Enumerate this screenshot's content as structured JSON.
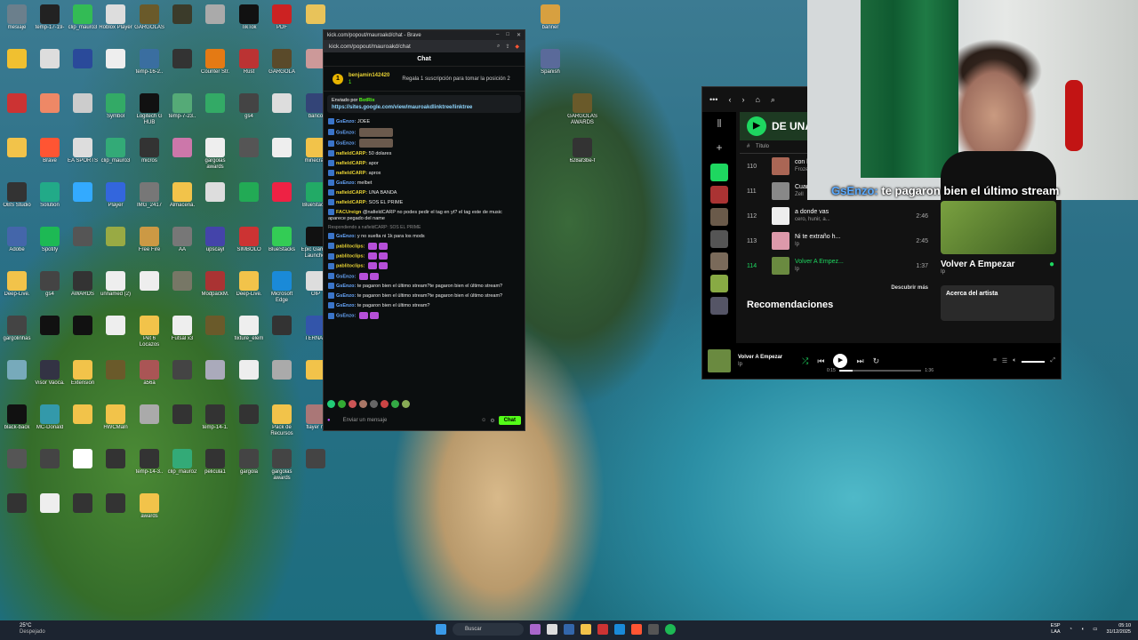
{
  "desktop_icons": [
    {
      "label": "mesiaje",
      "color": "#6b7f8c"
    },
    {
      "label": "temp-17-19-",
      "color": "#222"
    },
    {
      "label": "clip_mauro3",
      "color": "#3b5"
    },
    {
      "label": "Roblox Player",
      "color": "#ddd"
    },
    {
      "label": "GARGOLAS",
      "color": "#6a5a2a"
    },
    {
      "label": "",
      "color": "#3b3b2a"
    },
    {
      "label": "",
      "color": "#aaa"
    },
    {
      "label": "TikTok",
      "color": "#111"
    },
    {
      "label": "PDF",
      "color": "#c22"
    },
    {
      "label": "",
      "color": "#e8c35a"
    },
    {
      "label": "",
      "color": "#f0c030"
    },
    {
      "label": "",
      "color": "#ddd"
    },
    {
      "label": "",
      "color": "#2a4a9a"
    },
    {
      "label": "",
      "color": "#eee"
    },
    {
      "label": "temp-16-2..",
      "color": "#3a6ea0"
    },
    {
      "label": "",
      "color": "#333"
    },
    {
      "label": "Counter Str.",
      "color": "#e47a14"
    },
    {
      "label": "Rust",
      "color": "#b33"
    },
    {
      "label": "GARGOLA",
      "color": "#5a4a2a"
    },
    {
      "label": "",
      "color": "#c99"
    },
    {
      "label": "",
      "color": "#c33"
    },
    {
      "label": "",
      "color": "#e86"
    },
    {
      "label": "",
      "color": "#ccc"
    },
    {
      "label": "Symbol",
      "color": "#3a6"
    },
    {
      "label": "Logitech G HUB",
      "color": "#111"
    },
    {
      "label": "temp-7-23..",
      "color": "#5a7"
    },
    {
      "label": "",
      "color": "#3a6"
    },
    {
      "label": "gs4",
      "color": "#444"
    },
    {
      "label": "",
      "color": "#ddd"
    },
    {
      "label": "banco",
      "color": "#347"
    },
    {
      "label": "",
      "color": "#f2c34a"
    },
    {
      "label": "Brave",
      "color": "#f53"
    },
    {
      "label": "EA SPORTS",
      "color": "#ddd"
    },
    {
      "label": "clip_mauro3",
      "color": "#3a7"
    },
    {
      "label": "micros",
      "color": "#333"
    },
    {
      "label": "",
      "color": "#c7a"
    },
    {
      "label": "gargolas awards",
      "color": "#eee"
    },
    {
      "label": "",
      "color": "#555"
    },
    {
      "label": "",
      "color": "#eee"
    },
    {
      "label": "minecraft",
      "color": "#f2c34a"
    },
    {
      "label": "OBS Studio",
      "color": "#333"
    },
    {
      "label": "Solution",
      "color": "#2a8"
    },
    {
      "label": "",
      "color": "#3af"
    },
    {
      "label": "Player",
      "color": "#36d"
    },
    {
      "label": "IMG_2417",
      "color": "#777"
    },
    {
      "label": "Almacena.",
      "color": "#f2c34a"
    },
    {
      "label": "",
      "color": "#ddd"
    },
    {
      "label": "",
      "color": "#2a5"
    },
    {
      "label": "",
      "color": "#e24"
    },
    {
      "label": "BlueStacks",
      "color": "#2a6"
    },
    {
      "label": "Adobe",
      "color": "#46a"
    },
    {
      "label": "Spotify",
      "color": "#1db954"
    },
    {
      "label": "",
      "color": "#555"
    },
    {
      "label": "",
      "color": "#9a4"
    },
    {
      "label": "Free Fire",
      "color": "#c94"
    },
    {
      "label": "AA",
      "color": "#777"
    },
    {
      "label": "upscayl",
      "color": "#44a"
    },
    {
      "label": "SIMBOLO",
      "color": "#c33"
    },
    {
      "label": "BlueStacks",
      "color": "#3c5"
    },
    {
      "label": "Epic Games Launcher",
      "color": "#111"
    },
    {
      "label": "Deep-Live.",
      "color": "#f2c34a"
    },
    {
      "label": "gs4",
      "color": "#444"
    },
    {
      "label": "AWARDS",
      "color": "#333"
    },
    {
      "label": "unnamed (2)",
      "color": "#eee"
    },
    {
      "label": "",
      "color": "#eee"
    },
    {
      "label": "",
      "color": "#776"
    },
    {
      "label": "ModpackM.",
      "color": "#a33"
    },
    {
      "label": "Deep-Live.",
      "color": "#f2c34a"
    },
    {
      "label": "Microsoft Edge",
      "color": "#1a8ad8"
    },
    {
      "label": "OIP",
      "color": "#ddd"
    },
    {
      "label": "gargolinhas",
      "color": "#444"
    },
    {
      "label": "",
      "color": "#111"
    },
    {
      "label": "",
      "color": "#111"
    },
    {
      "label": "",
      "color": "#eee"
    },
    {
      "label": "Pet 6 Locazos",
      "color": "#f2c34a"
    },
    {
      "label": "Futsal x3",
      "color": "#eee"
    },
    {
      "label": "",
      "color": "#6a5a2a"
    },
    {
      "label": "fixture_elem",
      "color": "#eee"
    },
    {
      "label": "",
      "color": "#333"
    },
    {
      "label": "TERNAS",
      "color": "#35a"
    },
    {
      "label": "",
      "color": "#7ab"
    },
    {
      "label": "Visor Vaoca.",
      "color": "#334"
    },
    {
      "label": "Extension",
      "color": "#f2c34a"
    },
    {
      "label": "",
      "color": "#6a5a2a"
    },
    {
      "label": "a56a",
      "color": "#a55"
    },
    {
      "label": "",
      "color": "#444"
    },
    {
      "label": "",
      "color": "#aab"
    },
    {
      "label": "",
      "color": "#eee"
    },
    {
      "label": "",
      "color": "#aaa"
    },
    {
      "label": "",
      "color": "#f2c34a"
    },
    {
      "label": "black-back",
      "color": "#111"
    },
    {
      "label": "MC-Donald",
      "color": "#39a"
    },
    {
      "label": "",
      "color": "#f2c34a"
    },
    {
      "label": "HWCMaln",
      "color": "#f2c34a"
    },
    {
      "label": "",
      "color": "#aaa"
    },
    {
      "label": "",
      "color": "#333"
    },
    {
      "label": "temp-14-1.",
      "color": "#333"
    },
    {
      "label": "",
      "color": "#333"
    },
    {
      "label": "Pack de Recursos",
      "color": "#f2c34a"
    },
    {
      "label": "flayer n.",
      "color": "#a77"
    },
    {
      "label": "",
      "color": "#555"
    },
    {
      "label": "",
      "color": "#444"
    },
    {
      "label": "",
      "color": "#fff"
    },
    {
      "label": "",
      "color": "#333"
    },
    {
      "label": "temp-14-3..",
      "color": "#333"
    },
    {
      "label": "clip_mauro2",
      "color": "#3a7"
    },
    {
      "label": "pelicula1",
      "color": "#333"
    },
    {
      "label": "gargola",
      "color": "#444"
    },
    {
      "label": "gargolas awards",
      "color": "#444"
    },
    {
      "label": "",
      "color": "#444"
    },
    {
      "label": "",
      "color": "#333"
    },
    {
      "label": "",
      "color": "#eee"
    },
    {
      "label": "",
      "color": "#333"
    },
    {
      "label": "",
      "color": "#333"
    },
    {
      "label": "awards",
      "color": "#f2c34a"
    }
  ],
  "desktop_right_icons": [
    {
      "label": "banner",
      "color": "#d7a040"
    },
    {
      "label": "Spanish",
      "color": "#5a6a9a"
    },
    {
      "label": "GARGOLAS AWARDS",
      "color": "#6a5a2a"
    },
    {
      "label": "628af3be-f",
      "color": "#333"
    }
  ],
  "browser": {
    "title": "kick.com/popout/mauroakd/chat - Brave",
    "url": "kick.com/popout/mauroakd/chat",
    "chat_header": "Chat",
    "sub_user": "benjamin142420",
    "sub_count": "1",
    "sub_gift_text": "Regala 1 suscripción para tomar la posición 2",
    "pinned_by": "Enviado por",
    "pinned_user": "BotRix",
    "pinned_link": "https://sites.google.com/view/mauroakdlinktree/linktree",
    "messages": [
      {
        "user": "GsEnzo:",
        "text": "JOEE",
        "extra": ""
      },
      {
        "user": "GsEnzo:",
        "text": "",
        "extra": "photo"
      },
      {
        "user": "GsEnzo:",
        "text": "",
        "extra": "photo"
      },
      {
        "user": "nafieldCARP:",
        "text": "50 dolares",
        "extra": "",
        "yellow": true
      },
      {
        "user": "nafieldCARP:",
        "text": "apor",
        "extra": "",
        "yellow": true
      },
      {
        "user": "nafieldCARP:",
        "text": "aprox",
        "extra": "",
        "yellow": true
      },
      {
        "user": "GsEnzo:",
        "text": "melbet",
        "extra": ""
      },
      {
        "user": "nafieldCARP:",
        "text": "UNA BANDA",
        "extra": "",
        "yellow": true
      },
      {
        "user": "nafieldCARP:",
        "text": "SOS EL PRIME",
        "extra": "",
        "yellow": true
      },
      {
        "user": "FACUreign",
        "text": "@nafieldCARP no podes pedir el tag en yt? el tag este de music aparece pegado del name",
        "extra": "",
        "yellow": true
      },
      {
        "reply": "Respondiendo a nafieldCARP: SOS EL PRIME",
        "user": "GsEnzo:",
        "text": "y no suelta ni 1k para los mods",
        "extra": ""
      },
      {
        "user": "pablitoclips:",
        "text": "",
        "extra": "emoji",
        "yellow": true
      },
      {
        "user": "pablitoclips:",
        "text": "",
        "extra": "emoji",
        "yellow": true
      },
      {
        "user": "pablitoclips:",
        "text": "",
        "extra": "emoji",
        "yellow": true
      },
      {
        "user": "GsEnzo:",
        "text": "",
        "extra": "emoji"
      },
      {
        "user": "GsEnzo:",
        "text": "te pagaron bien el último stream?te pagaron bien el último stream?",
        "extra": ""
      },
      {
        "user": "GsEnzo:",
        "text": "te pagaron bien el último stream?te pagaron bien el último stream?",
        "extra": ""
      },
      {
        "user": "GsEnzo:",
        "text": "te pagaron bien el último stream?",
        "extra": ""
      },
      {
        "user": "GsEnzo:",
        "text": "",
        "extra": "emoji"
      }
    ],
    "input_placeholder": "Enviar un mensaje",
    "send_label": "Chat"
  },
  "spotify": {
    "banner": "DE UNA",
    "col_title": "Título",
    "tracks": [
      {
        "n": "110",
        "name": "con l",
        "artist": "Froze",
        "dur": "",
        "color": "#a65"
      },
      {
        "n": "111",
        "name": "Cuanto Vale...",
        "artist": "Zell",
        "dur": "2:13",
        "color": "#888"
      },
      {
        "n": "112",
        "name": "a donde vas",
        "artist": "cero, hunir, a...",
        "dur": "2:46",
        "color": "#eee"
      },
      {
        "n": "113",
        "name": "Ni te extraño h...",
        "artist": "Ip",
        "dur": "2:45",
        "color": "#d9a"
      },
      {
        "n": "114",
        "name": "Volver A Empez...",
        "artist": "Ip",
        "dur": "1:37",
        "color": "#6a8a40",
        "active": true
      }
    ],
    "discover": "Descubrir más",
    "reco": "Recomendaciones",
    "np_title": "Volver A Empezar",
    "np_artist": "Ip",
    "about": "Acerca del artista",
    "player_title": "Volver A Empezar",
    "player_artist": "Ip",
    "time_cur": "0:15",
    "time_total": "1:36",
    "progress": 0.16
  },
  "overlay": {
    "user": "GsEnzo:",
    "text": "te pagaron bien el último stream"
  },
  "taskbar": {
    "temp": "25°C",
    "weather": "Despejado",
    "search": "Buscar",
    "lang1": "ESP",
    "lang2": "LAA",
    "time": "05:10",
    "date": "31/12/2025"
  }
}
